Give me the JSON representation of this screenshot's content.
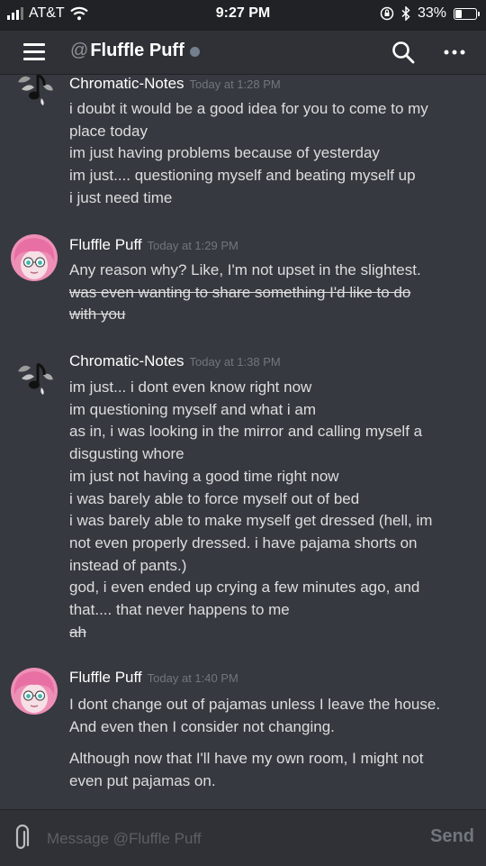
{
  "status_bar": {
    "carrier": "AT&T",
    "time": "9:27 PM",
    "battery": "33%",
    "battery_level": 0.33
  },
  "header": {
    "at": "@",
    "channel_name": "Fluffle Puff",
    "status": "offline",
    "icons": [
      "menu-icon",
      "search-icon",
      "more-icon"
    ]
  },
  "messages": [
    {
      "author": "Chromatic-Notes",
      "timestamp": "Today at 1:28 PM",
      "avatar": "music-note-avatar",
      "lines": [
        "i doubt it would be a good idea for you to come to my",
        "place today",
        "im just having problems because of yesterday",
        "im just.... questioning myself and beating myself up",
        "i just need time"
      ]
    },
    {
      "author": "Fluffle Puff",
      "timestamp": "Today at 1:29 PM",
      "avatar": "pink-hair-avatar",
      "lines": [
        "Any reason why? Like, I'm not upset in the slightest."
      ],
      "struck_lines": [
        "was even wanting to share something I'd like to do",
        "with you"
      ]
    },
    {
      "author": "Chromatic-Notes",
      "timestamp": "Today at 1:38 PM",
      "avatar": "music-note-avatar",
      "lines": [
        "im just... i dont even know right now",
        "im questioning myself and what i am",
        "as in, i was looking in the mirror and calling myself a",
        "disgusting whore",
        "im just not having a good time right now",
        "i was barely able to force myself out of bed",
        "i was barely able to make myself get dressed (hell, im",
        "not even properly dressed. i have pajama shorts on",
        "instead of pants.)",
        "god, i even ended up crying a few minutes ago, and",
        "that.... that never happens to me"
      ],
      "struck_lines": [
        "ah"
      ]
    },
    {
      "author": "Fluffle Puff",
      "timestamp": "Today at 1:40 PM",
      "avatar": "pink-hair-avatar",
      "lines": [
        "I dont change out of pajamas unless I leave the house.",
        "And even then I consider not changing."
      ],
      "lines_2": [
        "Although now that I'll have my own room, I might not",
        "even put pajamas on."
      ]
    }
  ],
  "composer": {
    "placeholder": "Message @Fluffle Puff",
    "send_label": "Send"
  },
  "colors": {
    "background": "#36393f",
    "header": "#2f3136",
    "status_bar": "#202225",
    "text": "#dcddde",
    "timestamp": "#72767d",
    "avatar_pink": "#ee8fb6"
  }
}
